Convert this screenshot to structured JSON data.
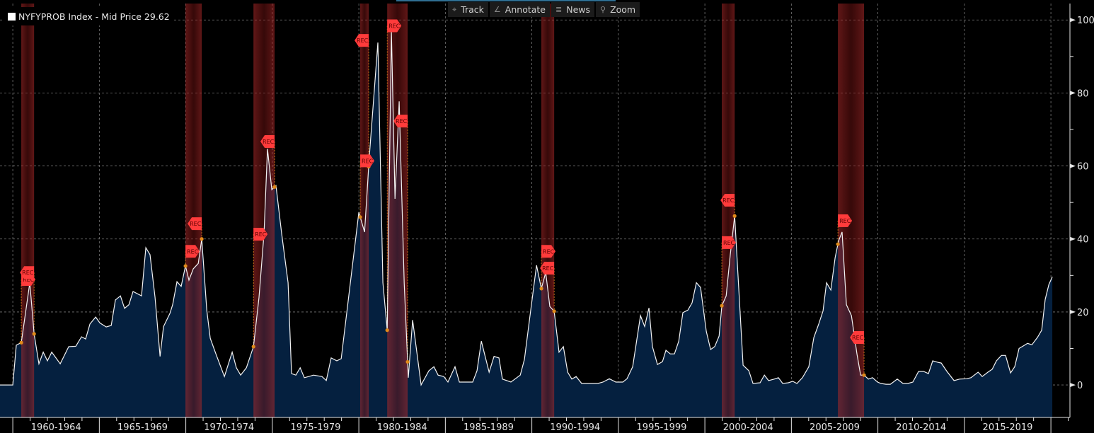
{
  "legend": {
    "label": "NYFYPROB Index - Mid Price 29.62",
    "color": "#ffffff"
  },
  "toolbar": [
    {
      "label": "Track",
      "icon": "crosshair-icon",
      "glyph": "⌖"
    },
    {
      "label": "Annotate",
      "icon": "pencil-icon",
      "glyph": "∠"
    },
    {
      "label": "News",
      "icon": "news-icon",
      "glyph": "≣"
    },
    {
      "label": "Zoom",
      "icon": "magnifier-icon",
      "glyph": "⚲"
    }
  ],
  "colors": {
    "fill": "#05203f",
    "line": "#f2f2f2",
    "band": "#8a1c1c",
    "flag": "#ff3b3b",
    "dot": "#e08a1a",
    "grid": "#777777"
  },
  "chart_data": {
    "type": "area",
    "title": "NYFYPROB Index - Mid Price 29.62",
    "xlim": [
      1959.26,
      2021.1
    ],
    "ylim": [
      -8.9,
      104.5
    ],
    "y_ticks": [
      0,
      20,
      40,
      60,
      80,
      100
    ],
    "y_minor_ticks": [
      10,
      30,
      50,
      70,
      90
    ],
    "y_axis_position": "right",
    "grid": true,
    "x_tick_labels": [
      "1960-1964",
      "1965-1969",
      "1970-1974",
      "1975-1979",
      "1980-1984",
      "1985-1989",
      "1990-1994",
      "1995-1999",
      "2000-2004",
      "2005-2009",
      "2010-2014",
      "2015-2019"
    ],
    "series": [
      {
        "name": "NYFYPROB Index",
        "x": [
          1959.26,
          1960.0,
          1960.2,
          1960.49,
          1960.98,
          1961.23,
          1961.51,
          1961.76,
          1962.0,
          1962.25,
          1962.74,
          1963.23,
          1963.64,
          1963.97,
          1964.21,
          1964.46,
          1964.79,
          1965.03,
          1965.4,
          1965.69,
          1965.93,
          1966.22,
          1966.46,
          1966.71,
          1966.95,
          1967.44,
          1967.69,
          1967.93,
          1968.22,
          1968.51,
          1968.71,
          1969.08,
          1969.24,
          1969.49,
          1969.73,
          1969.98,
          1970.18,
          1970.43,
          1970.72,
          1970.92,
          1971.21,
          1971.41,
          1971.74,
          1972.23,
          1972.68,
          1972.92,
          1973.17,
          1973.5,
          1973.91,
          1974.23,
          1974.52,
          1974.72,
          1974.97,
          1975.21,
          1975.54,
          1975.91,
          1976.11,
          1976.36,
          1976.61,
          1976.85,
          1977.1,
          1977.38,
          1977.87,
          1978.12,
          1978.4,
          1978.73,
          1978.98,
          1979.63,
          1980.0,
          1980.33,
          1980.61,
          1981.1,
          1981.39,
          1981.64,
          1981.88,
          1982.09,
          1982.33,
          1982.62,
          1982.86,
          1983.11,
          1983.6,
          1984.05,
          1984.34,
          1984.58,
          1984.91,
          1985.15,
          1985.56,
          1985.81,
          1986.58,
          1986.83,
          1987.08,
          1987.53,
          1987.81,
          1988.1,
          1988.3,
          1988.79,
          1989.33,
          1989.57,
          1989.86,
          1990.27,
          1990.55,
          1990.8,
          1991.04,
          1991.29,
          1991.57,
          1991.82,
          1992.07,
          1992.31,
          1992.56,
          1992.88,
          1993.82,
          1994.11,
          1994.48,
          1994.85,
          1995.26,
          1995.5,
          1995.83,
          1996.28,
          1996.52,
          1996.77,
          1996.97,
          1997.26,
          1997.55,
          1997.75,
          1998.0,
          1998.24,
          1998.49,
          1998.73,
          1999.02,
          1999.26,
          1999.51,
          1999.75,
          2000.08,
          2000.33,
          2000.57,
          2000.82,
          2000.98,
          2001.23,
          2001.47,
          2001.72,
          2002.21,
          2002.54,
          2002.78,
          2003.19,
          2003.44,
          2003.68,
          2004.01,
          2004.25,
          2004.5,
          2004.83,
          2005.07,
          2005.32,
          2005.64,
          2006.01,
          2006.3,
          2006.58,
          2006.83,
          2007.03,
          2007.28,
          2007.53,
          2007.73,
          2007.93,
          2008.18,
          2008.47,
          2008.79,
          2009.0,
          2009.2,
          2009.45,
          2009.69,
          2009.98,
          2010.18,
          2010.47,
          2010.72,
          2011.12,
          2011.45,
          2011.74,
          2012.02,
          2012.35,
          2012.64,
          2012.92,
          2013.17,
          2013.46,
          2013.66,
          2013.99,
          2014.4,
          2014.72,
          2015.13,
          2015.38,
          2015.79,
          2016.03,
          2016.36,
          2016.61,
          2016.85,
          2017.14,
          2017.38,
          2017.67,
          2017.91,
          2018.16,
          2018.41,
          2018.65,
          2018.9,
          2019.22,
          2019.47,
          2019.67,
          2019.88,
          2020.08
        ],
        "y": [
          0,
          0,
          10.9,
          11.6,
          28,
          14,
          5.8,
          9,
          6.6,
          9,
          5.8,
          10.5,
          10.6,
          13.2,
          12.6,
          16.7,
          18.6,
          17,
          15.9,
          16.3,
          23.3,
          24.4,
          21,
          22,
          25.6,
          24.4,
          37.6,
          35.7,
          24,
          7.8,
          16,
          19.6,
          22,
          28.3,
          27,
          32.6,
          28.7,
          31.8,
          33.3,
          40,
          20.5,
          12.8,
          8.5,
          2.3,
          9,
          4.7,
          2.7,
          4.7,
          10.5,
          24,
          41.5,
          64.7,
          53.5,
          54.6,
          41.5,
          28,
          3.1,
          2.7,
          4.7,
          2,
          2.3,
          2.7,
          2.3,
          1.2,
          7.4,
          6.6,
          7.2,
          32.8,
          47.3,
          41.9,
          62.8,
          93.8,
          28,
          15,
          97,
          51,
          77.7,
          28,
          2,
          17.8,
          0,
          3.9,
          5,
          2.7,
          2.3,
          0.8,
          5,
          0.8,
          0.8,
          3.9,
          12,
          3.5,
          7.8,
          7.4,
          1.6,
          0.8,
          2.7,
          7,
          17.8,
          32.8,
          26.4,
          30.8,
          21.5,
          20.2,
          9,
          10.5,
          3.5,
          1.6,
          2.3,
          0.4,
          0.4,
          0.8,
          1.7,
          0.8,
          0.8,
          1.7,
          5,
          19,
          16,
          21.1,
          10.5,
          5.6,
          6.4,
          9.5,
          8.5,
          8.5,
          12,
          19.8,
          20.5,
          22.5,
          28,
          26.7,
          14.7,
          9.7,
          10.5,
          13.4,
          21.7,
          24.4,
          35.7,
          46.3,
          5.4,
          3.9,
          0.4,
          0.6,
          2.7,
          1.2,
          1.6,
          2,
          0.4,
          0.6,
          1,
          0.4,
          2,
          5,
          13,
          16.7,
          20.3,
          28,
          26,
          34.9,
          39.5,
          41.9,
          22,
          19,
          8.5,
          2.7,
          2.7,
          1.6,
          2,
          0.8,
          0.4,
          0.2,
          0.2,
          1.6,
          0.4,
          0.4,
          0.8,
          3.7,
          3.7,
          3.1,
          6.6,
          6.2,
          6,
          3.7,
          1.2,
          1.6,
          1.7,
          2,
          3.5,
          2.3,
          3.5,
          4.3,
          6.6,
          8.1,
          8.1,
          3.3,
          5,
          10,
          10.7,
          11.4,
          11,
          13,
          15,
          23.4,
          27.5,
          29.62
        ]
      }
    ],
    "recessions": [
      {
        "start": 1960.49,
        "end": 1961.23,
        "flag_start": 28.9,
        "flag_end": 30.8,
        "label": "REC"
      },
      {
        "start": 1969.98,
        "end": 1970.92,
        "flag_start": 36.6,
        "flag_end": 44.2,
        "label": "REC"
      },
      {
        "start": 1973.91,
        "end": 1975.13,
        "flag_start": 41.3,
        "flag_end": 66.7,
        "label": "REC"
      },
      {
        "start": 1980.08,
        "end": 1980.57,
        "flag_start": 61.4,
        "flag_end": 94.4,
        "label": "REC"
      },
      {
        "start": 1981.64,
        "end": 1982.82,
        "flag_start": 98.4,
        "flag_end": 72.3,
        "label": "REC"
      },
      {
        "start": 1990.55,
        "end": 1991.29,
        "flag_start": 36.6,
        "flag_end": 32.0,
        "label": "REC"
      },
      {
        "start": 2000.98,
        "end": 2001.72,
        "flag_start": 39.0,
        "flag_end": 50.6,
        "label": "REC"
      },
      {
        "start": 2007.69,
        "end": 2009.2,
        "flag_start": 45.0,
        "flag_end": 13.0,
        "label": "REC"
      }
    ]
  }
}
